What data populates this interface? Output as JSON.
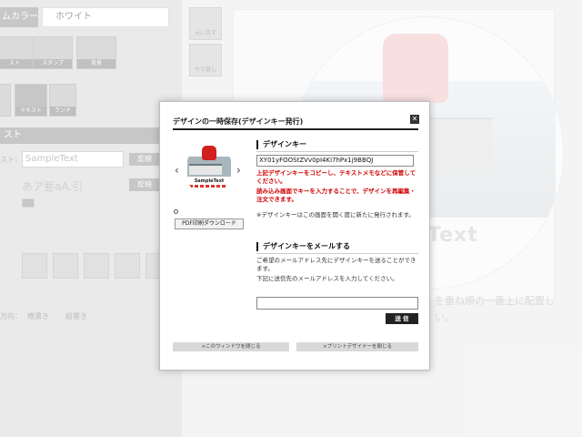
{
  "background": {
    "color_row_label": "ムカラー",
    "color_value": "ホワイト",
    "tool_undo": "元に戻す",
    "tool_redo": "やり直し",
    "tile_labels": [
      "スト",
      "スタンプ",
      "背景"
    ],
    "tile2_labels": [
      "",
      "テキスト",
      "ランド"
    ],
    "section_text": "スト",
    "text_label": "スト：",
    "text_value": "SampleText",
    "font_preview": "あア亜aA.引",
    "apply_label": "反映",
    "canvas_text": "Text",
    "right_note": "を重ね順の一番上に配置し",
    "right_note2": "い。",
    "bottom_label": "方向：",
    "bottom_opt1": "横書き",
    "bottom_opt2": "縦書き"
  },
  "modal": {
    "title": "デザインの一時保存(デザインキー発行)",
    "close_label": "✕",
    "prev_arrow": "‹",
    "next_arrow": "›",
    "thumb_text": "SampleText",
    "pdf_button": "PDF印刷ダウンロード",
    "design_key_heading": "デザインキー",
    "design_key_value": "XY01yFOOStZVv0pI4Ki7hPx1j9BBQJ",
    "red_note_1": "上記デザインキーをコピーし、テキストメモなどに保管してください。",
    "red_note_2": "読み込み画面でキーを入力することで、デザインを再編集・注文できます。",
    "gray_note": "※デザインキーはこの画面を開く度に新たに発行されます。",
    "mail_heading": "デザインキーをメールする",
    "mail_desc_1": "ご希望のメールアドレス先にデザインキーを送ることができます。",
    "mail_desc_2": "下記に送信先のメールアドレスを入力してください。",
    "mail_value": "",
    "send_button": "送 信",
    "close_window_button": "×このウィンドウを閉じる",
    "close_designer_button": "×プリントデザイナーを閉じる"
  },
  "colors": {
    "accent_red": "#d10000",
    "dark": "#222222"
  }
}
